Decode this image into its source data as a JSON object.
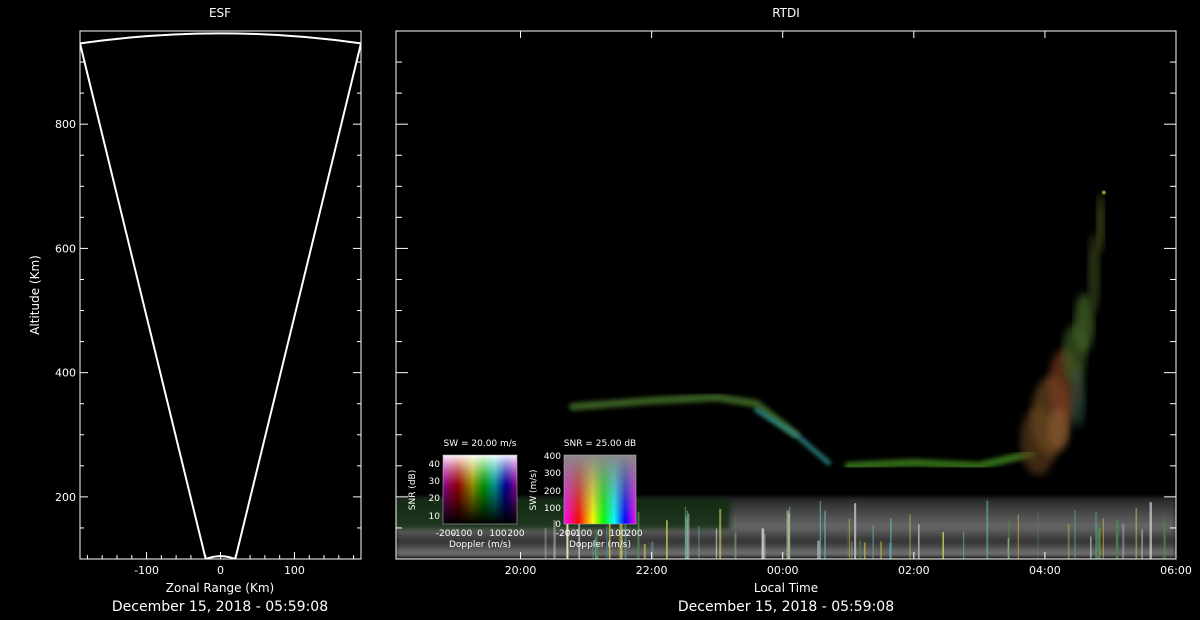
{
  "chart_data": [
    {
      "type": "line",
      "title": "ESF",
      "xlabel": "Zonal Range (Km)",
      "ylabel": "Altitude (Km)",
      "timestamp": "December 15, 2018 - 05:59:08",
      "xlim": [
        -190,
        190
      ],
      "ylim": [
        100,
        950
      ],
      "xticks": [
        -100,
        0,
        100
      ],
      "yticks": [
        200,
        400,
        600,
        800
      ],
      "xtick_labels": [
        "-100",
        "0",
        "100"
      ],
      "ytick_labels": [
        "200",
        "400",
        "600",
        "800"
      ],
      "series": [
        {
          "values": [
            {
              "x": -20,
              "y": 100
            },
            {
              "x": -190,
              "y": 930
            },
            {
              "x": -120,
              "y": 943
            },
            {
              "x": 0,
              "y": 948
            },
            {
              "x": 120,
              "y": 943
            },
            {
              "x": 190,
              "y": 930
            },
            {
              "x": 20,
              "y": 100
            },
            {
              "x": 0,
              "y": 103
            },
            {
              "x": -20,
              "y": 100
            }
          ]
        }
      ]
    },
    {
      "type": "heatmap",
      "title": "RTDI",
      "xlabel": "Local Time",
      "timestamp": "December 15, 2018 - 05:59:08",
      "xlim": [
        18.1,
        30
      ],
      "ylim": [
        100,
        950
      ],
      "xtick_labels": [
        "20:00",
        "22:00",
        "00:00",
        "02:00",
        "04:00",
        "06:00"
      ],
      "xticks": [
        20,
        22,
        24,
        26,
        28,
        30
      ],
      "yticks": [
        200,
        400,
        600,
        800
      ],
      "features": [
        {
          "kind": "layer",
          "x": [
            20.8,
            22.0,
            23.0,
            23.6,
            24.2
          ],
          "y": [
            345,
            355,
            360,
            350,
            300
          ],
          "color": "#3f6b28"
        },
        {
          "kind": "layer",
          "x": [
            23.6,
            24.2,
            24.7
          ],
          "y": [
            340,
            300,
            255
          ],
          "color": "#2d8a8a"
        },
        {
          "kind": "layer",
          "x": [
            25.0,
            26.0,
            27.0,
            27.8
          ],
          "y": [
            250,
            255,
            250,
            270
          ],
          "color": "#3a7a1c"
        },
        {
          "kind": "plume",
          "x": [
            27.8,
            28.4,
            28.9
          ],
          "y": [
            300,
            450,
            680
          ],
          "color": "#6b4a20"
        },
        {
          "kind": "band",
          "x": [
            18.1,
            30.0
          ],
          "y": [
            110,
            200
          ],
          "color": "#9a9a9a"
        }
      ],
      "legends": [
        {
          "title": "SW = 20.00 m/s",
          "xlabel": "Doppler (m/s)",
          "ylabel": "SNR (dB)",
          "xtick_labels": [
            "-200",
            "-100",
            "0",
            "100",
            "200"
          ],
          "ytick_labels": [
            "10",
            "20",
            "30",
            "40"
          ]
        },
        {
          "title": "SNR = 25.00 dB",
          "xlabel": "Doppler (m/s)",
          "ylabel": "SW (m/s)",
          "xtick_labels": [
            "-200",
            "-100",
            "0",
            "100",
            "200"
          ],
          "ytick_labels": [
            "0",
            "100",
            "200",
            "300",
            "400"
          ]
        }
      ]
    }
  ]
}
